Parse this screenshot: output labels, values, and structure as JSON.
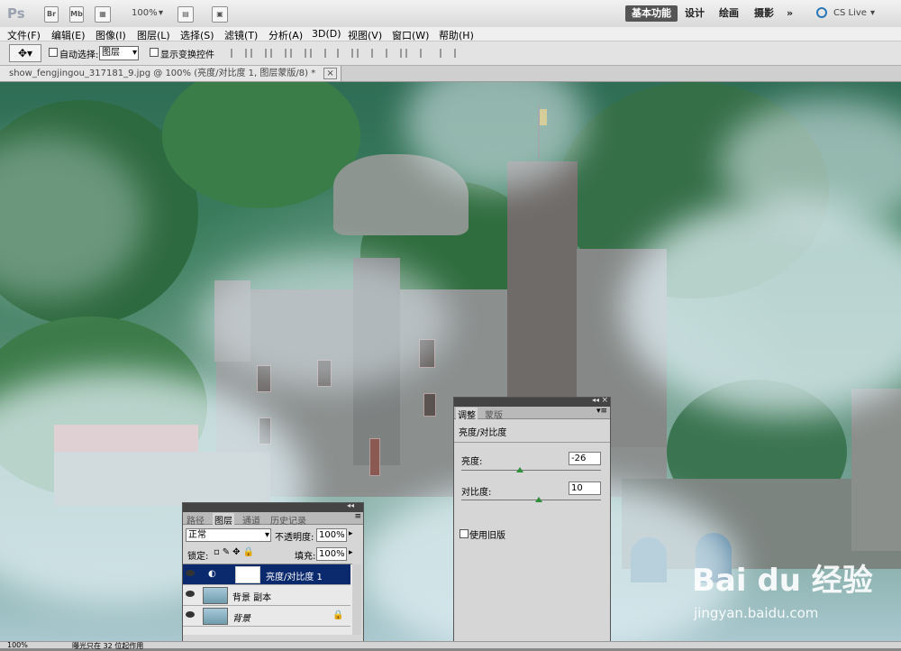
{
  "app": {
    "logo": "Ps",
    "toolbar_icons": [
      "Br",
      "Mb"
    ],
    "zoom": "100%",
    "workspaces": [
      "基本功能",
      "设计",
      "绘画",
      "摄影"
    ],
    "more": "»",
    "cs_live": "CS Live"
  },
  "menu": {
    "items": [
      "文件(F)",
      "编辑(E)",
      "图像(I)",
      "图层(L)",
      "选择(S)",
      "滤镜(T)",
      "分析(A)",
      "3D(D)",
      "视图(V)",
      "窗口(W)",
      "帮助(H)"
    ]
  },
  "options": {
    "auto_select_label": "自动选择:",
    "auto_select_value": "图层",
    "show_transform_label": "显示变换控件"
  },
  "document": {
    "tab_title": "show_fengjingou_317181_9.jpg @ 100% (亮度/对比度 1, 图层蒙版/8) *",
    "close": "×"
  },
  "adjust_panel": {
    "tabs": [
      "调整",
      "蒙版"
    ],
    "title": "亮度/对比度",
    "brightness_label": "亮度:",
    "brightness_value": "-26",
    "contrast_label": "对比度:",
    "contrast_value": "10",
    "legacy_label": "使用旧版"
  },
  "layers_panel": {
    "tabs": [
      "路径",
      "图层",
      "通道",
      "历史记录"
    ],
    "blend_mode": "正常",
    "opacity_label": "不透明度:",
    "opacity_value": "100%",
    "lock_label": "锁定:",
    "fill_label": "填充:",
    "fill_value": "100%",
    "layers": [
      {
        "name": "亮度/对比度 1"
      },
      {
        "name": "背景 副本"
      },
      {
        "name": "背景"
      }
    ]
  },
  "status": {
    "zoom": "100%",
    "info": "曝光只在 32 位起作用"
  },
  "watermark": {
    "brand": "Bai du 经验",
    "url": "jingyan.baidu.com"
  }
}
